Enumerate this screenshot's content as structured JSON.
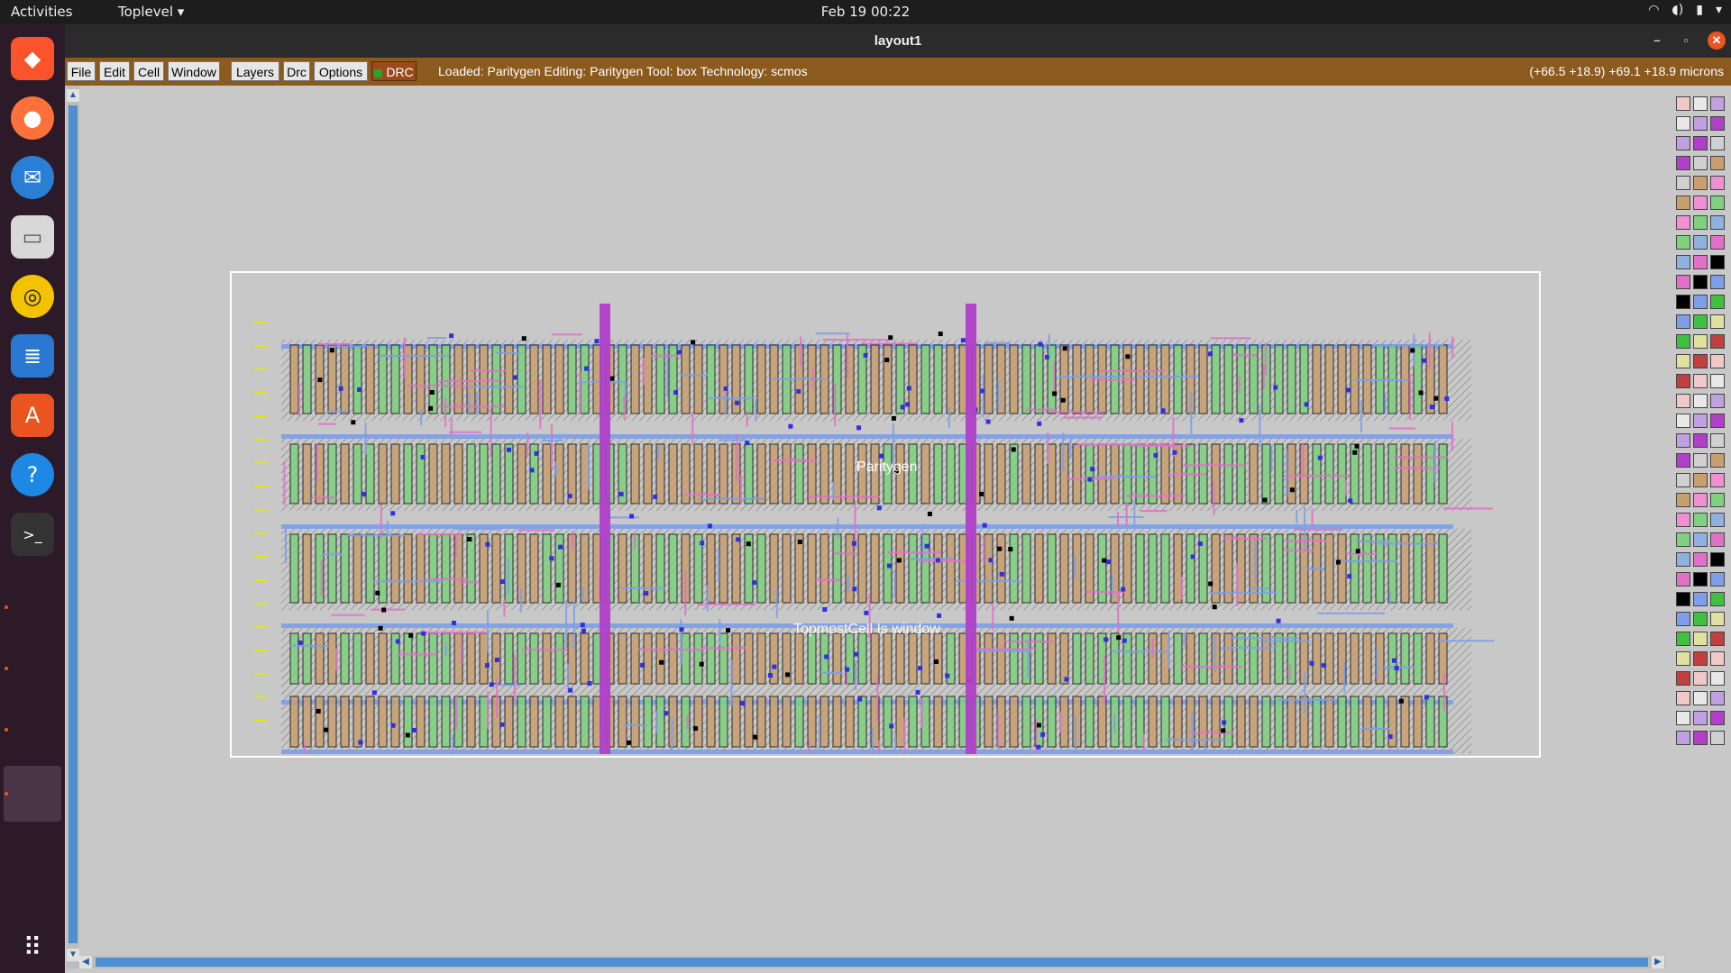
{
  "topbar": {
    "activities": "Activities",
    "app_menu": "Toplevel ▾",
    "clock": "Feb 19  00:22"
  },
  "dock": {
    "apps": [
      {
        "name": "brave-browser-icon",
        "color": "#fb542b"
      },
      {
        "name": "firefox-icon",
        "color": "#ff7139"
      },
      {
        "name": "thunderbird-icon",
        "color": "#2a7fd4"
      },
      {
        "name": "files-icon",
        "color": "#e8e8e8"
      },
      {
        "name": "rhythmbox-icon",
        "color": "#f3c300"
      },
      {
        "name": "libreoffice-writer-icon",
        "color": "#2a78d1"
      },
      {
        "name": "app-center-icon",
        "color": "#e95420"
      },
      {
        "name": "help-icon",
        "color": "#1e88e5"
      },
      {
        "name": "terminal-icon",
        "color": "#333333"
      }
    ]
  },
  "window": {
    "title": "layout1"
  },
  "menubar": {
    "items": [
      "File",
      "Edit",
      "Cell",
      "Window",
      "Layers",
      "Drc",
      "Options"
    ],
    "drc_label": "DRC",
    "status": "Loaded: Paritygen Editing: Paritygen Tool: box  Technology: scmos",
    "coords": "(+66.5 +18.9) +69.1 +18.9 microns"
  },
  "canvas": {
    "cell_name": "Paritygen",
    "overlay_text": "TopmostCell Is window"
  },
  "colors": {
    "metal1": "#7c9fe8",
    "metal2": "#e070c8",
    "poly": "#e0608f",
    "diffusion_n": "#7fd07f",
    "diffusion_p": "#c8a070",
    "via": "#b040c8",
    "label": "#e8e800"
  }
}
